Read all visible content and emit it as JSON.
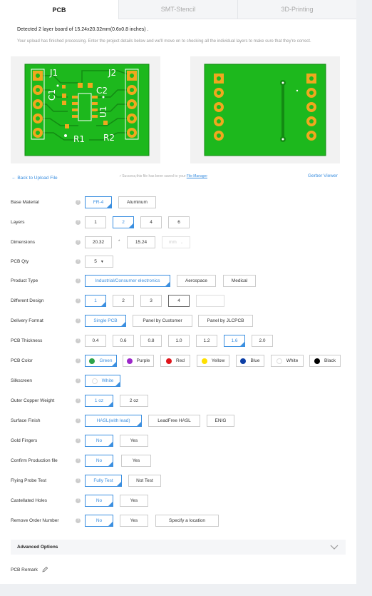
{
  "tabs": [
    {
      "label": "PCB",
      "active": true
    },
    {
      "label": "SMT-Stencil",
      "active": false
    },
    {
      "label": "3D-Printing",
      "active": false
    }
  ],
  "detected_text": "Detected 2 layer board of 15.24x20.32mm(0.6x0.8 inches) .",
  "upload_message": "Your upload has finished processing. Enter the project details below and we'll move on to checking all the individual layers to make sure that they're correct.",
  "pcb_preview": {
    "top_labels": {
      "j1": "J1",
      "j2": "J2",
      "c1": "C1",
      "c2": "C2",
      "u1": "U1",
      "r1": "R1",
      "r2": "R2"
    },
    "colors": {
      "board": "#1db81d",
      "copper_dark": "#138a13",
      "silkscreen": "#ffffff",
      "pad": "#f0a81e",
      "background": "#f2f2f2"
    }
  },
  "back_link": "Back to Upload File",
  "success_text": "Success,this file has been saved to your ",
  "success_link": "File Manager",
  "gerber_viewer": "Gerber Viewer",
  "form": {
    "base_material": {
      "label": "Base Material",
      "options": [
        "FR-4",
        "Aluminum"
      ],
      "selected": "FR-4"
    },
    "layers": {
      "label": "Layers",
      "options": [
        "1",
        "2",
        "4",
        "6"
      ],
      "selected": "2"
    },
    "dimensions": {
      "label": "Dimensions",
      "width": "20.32",
      "separator": "*",
      "height": "15.24",
      "unit": "mm"
    },
    "pcb_qty": {
      "label": "PCB Qty",
      "value": "5"
    },
    "product_type": {
      "label": "Product Type",
      "options": [
        "Industrial/Consumer electronics",
        "Aerospace",
        "Medical"
      ],
      "selected": "Industrial/Consumer electronics"
    },
    "different_design": {
      "label": "Different Design",
      "options": [
        "1",
        "2",
        "3",
        "4",
        ""
      ],
      "selected": "1"
    },
    "delivery_format": {
      "label": "Delivery Format",
      "options": [
        "Single PCB",
        "Panel by Customer",
        "Panel by JLCPCB"
      ],
      "selected": "Single PCB"
    },
    "pcb_thickness": {
      "label": "PCB Thickness",
      "options": [
        "0.4",
        "0.6",
        "0.8",
        "1.0",
        "1.2",
        "1.6",
        "2.0"
      ],
      "selected": "1.6"
    },
    "pcb_color": {
      "label": "PCB Color",
      "options": [
        {
          "name": "Green",
          "color": "#2da34a"
        },
        {
          "name": "Purple",
          "color": "#9c27c9"
        },
        {
          "name": "Red",
          "color": "#e0141b"
        },
        {
          "name": "Yellow",
          "color": "#ffe000"
        },
        {
          "name": "Blue",
          "color": "#0d3fa6"
        },
        {
          "name": "White",
          "color": "#ffffff"
        },
        {
          "name": "Black",
          "color": "#000000"
        }
      ],
      "selected": "Green"
    },
    "silkscreen": {
      "label": "Silkscreen",
      "value": "White"
    },
    "outer_copper_weight": {
      "label": "Outer Copper Weight",
      "options": [
        "1 oz",
        "2 oz"
      ],
      "selected": "1 oz"
    },
    "surface_finish": {
      "label": "Surface Finish",
      "options": [
        "HASL(with lead)",
        "LeadFree HASL",
        "ENIG"
      ],
      "selected": "HASL(with lead)"
    },
    "gold_fingers": {
      "label": "Gold Fingers",
      "options": [
        "No",
        "Yes"
      ],
      "selected": "No"
    },
    "confirm_production_file": {
      "label": "Confirm Production file",
      "options": [
        "No",
        "Yes"
      ],
      "selected": "No"
    },
    "flying_probe_test": {
      "label": "Flying Probe Test",
      "options": [
        "Fully Test",
        "Not Test"
      ],
      "selected": "Fully Test"
    },
    "castellated_holes": {
      "label": "Castellated Holes",
      "options": [
        "No",
        "Yes"
      ],
      "selected": "No"
    },
    "remove_order_number": {
      "label": "Remove Order Number",
      "options": [
        "No",
        "Yes",
        "Specify a location"
      ],
      "selected": "No"
    }
  },
  "advanced_options": "Advanced Options",
  "pcb_remark": "PCB Remark",
  "help_glyph": "?",
  "accent_color": "#3b8fe0"
}
